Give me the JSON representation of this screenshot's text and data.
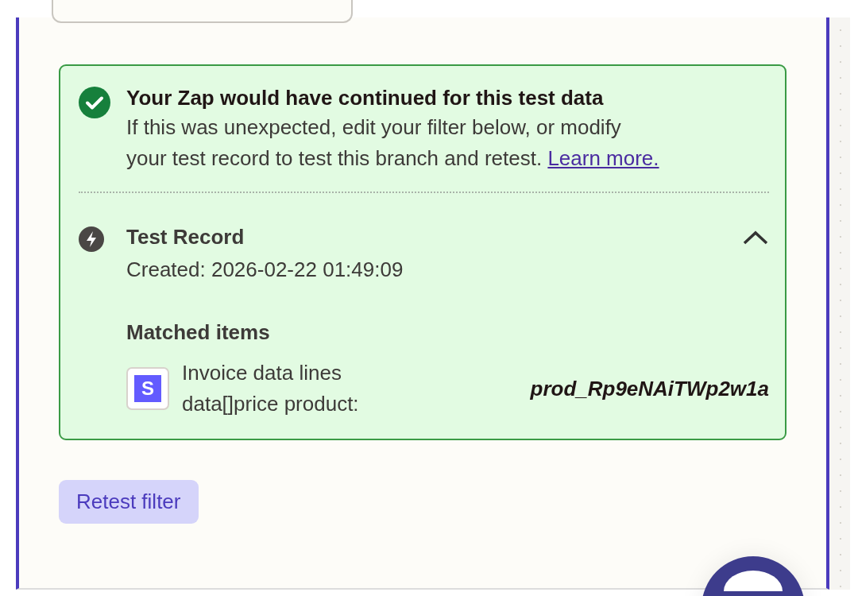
{
  "result": {
    "passed": true,
    "title": "Your Zap would have continued for this test data",
    "message": "If this was unexpected, edit your filter below, or modify your test record to test this branch and retest.",
    "link": "Learn more."
  },
  "test_record": {
    "title": "Test Record",
    "expanded": true,
    "created": "Created: 2026-02-22 01:49:09",
    "matched_heading": "Matched items",
    "items": [
      {
        "icon_letter": "S",
        "label": "Invoice data lines data[]price product:",
        "value": "prod_Rp9eNAiTWp2w1a"
      }
    ]
  },
  "buttons": [
    {
      "label": "Retest filter"
    }
  ]
}
